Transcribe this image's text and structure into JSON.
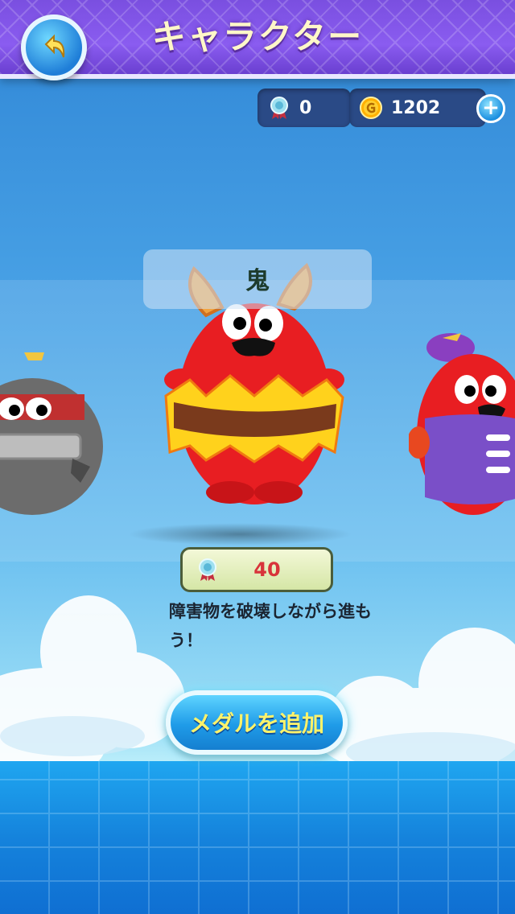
{
  "header": {
    "title": "キャラクター"
  },
  "currency": {
    "medals": "0",
    "coins": "1202",
    "plus": "+"
  },
  "character": {
    "name": "鬼",
    "price": "40",
    "description": "障害物を破壊しながら進もう！"
  },
  "actions": {
    "add_medal": "メダルを追加"
  },
  "colors": {
    "header": "#8a5cf0",
    "accent": "#1f9be8",
    "price_text": "#d8333a",
    "button_text": "#fff36a"
  }
}
